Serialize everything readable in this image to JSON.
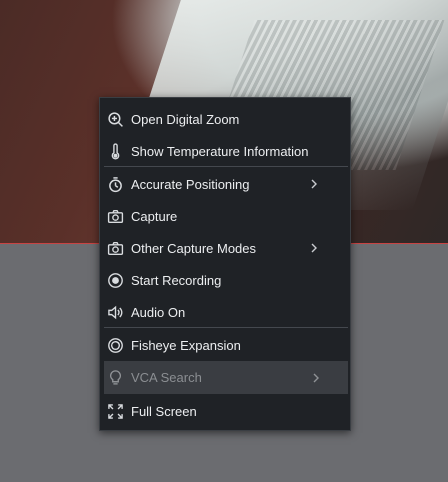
{
  "menu": {
    "items": [
      {
        "label": "Open Digital Zoom",
        "icon": "zoom-in-icon",
        "submenu": false,
        "enabled": true
      },
      {
        "label": "Show Temperature Information",
        "icon": "thermometer-icon",
        "submenu": false,
        "enabled": true
      },
      {
        "label": "Accurate Positioning",
        "icon": "stopwatch-icon",
        "submenu": true,
        "enabled": true
      },
      {
        "label": "Capture",
        "icon": "camera-icon",
        "submenu": false,
        "enabled": true
      },
      {
        "label": "Other Capture Modes",
        "icon": "camera-icon",
        "submenu": true,
        "enabled": true
      },
      {
        "label": "Start Recording",
        "icon": "record-icon",
        "submenu": false,
        "enabled": true
      },
      {
        "label": "Audio On",
        "icon": "speaker-icon",
        "submenu": false,
        "enabled": true
      },
      {
        "label": "Fisheye Expansion",
        "icon": "fisheye-icon",
        "submenu": false,
        "enabled": true
      },
      {
        "label": "VCA Search",
        "icon": "lightbulb-icon",
        "submenu": true,
        "enabled": false
      },
      {
        "label": "Full Screen",
        "icon": "fullscreen-icon",
        "submenu": false,
        "enabled": true
      }
    ]
  },
  "colors": {
    "menu_bg": "#1f2226",
    "text": "#eceef0",
    "disabled_text": "#8b8e92",
    "frame_border": "#c84343"
  }
}
